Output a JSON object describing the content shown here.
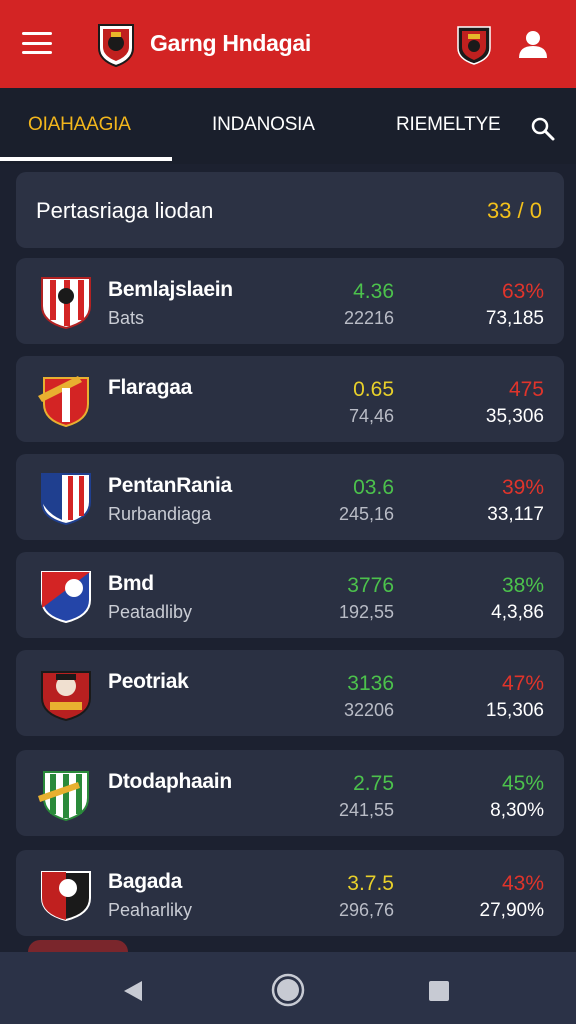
{
  "header": {
    "title": "Garng Hndagai",
    "menu_icon": "hamburger-menu-icon",
    "user_icon": "user-icon",
    "color": "#d32424"
  },
  "tabs": [
    {
      "label": "OIAHAAGIA",
      "active": true
    },
    {
      "label": "INDANOSIA",
      "active": false
    },
    {
      "label": "RIEMELTYE",
      "active": false
    }
  ],
  "summary": {
    "title": "Pertasriaga liodan",
    "score": "33 / 0"
  },
  "rows": [
    {
      "name": "Bemlajslaein",
      "sub": "Bats",
      "v1": "4.36",
      "v1_color": "#4cc24c",
      "v2": "22216",
      "p1": "63%",
      "p1_color": "#e0342b",
      "p2": "73,185"
    },
    {
      "name": "Flaragaa",
      "sub": "",
      "v1": "0.65",
      "v1_color": "#e8d02a",
      "v2": "74,46",
      "p1": "475",
      "p1_color": "#e0342b",
      "p2": "35,306"
    },
    {
      "name": "PentanRania",
      "sub": "Rurbandiaga",
      "v1": "03.6",
      "v1_color": "#4cc24c",
      "v2": "245,16",
      "p1": "39%",
      "p1_color": "#e0342b",
      "p2": "33,117"
    },
    {
      "name": "Bmd",
      "sub": "Peatadliby",
      "v1": "3776",
      "v1_color": "#4cc24c",
      "v2": "192,55",
      "p1": "38%",
      "p1_color": "#4cc24c",
      "p2": "4,3,86"
    },
    {
      "name": "Peotriak",
      "sub": "",
      "v1": "3136",
      "v1_color": "#4cc24c",
      "v2": "32206",
      "p1": "47%",
      "p1_color": "#e0342b",
      "p2": "15,306"
    },
    {
      "name": "Dtodaphaain",
      "sub": "",
      "v1": "2.75",
      "v1_color": "#4cc24c",
      "v2": "241,55",
      "p1": "45%",
      "p1_color": "#4cc24c",
      "p2": "8,30%"
    },
    {
      "name": "Bagada",
      "sub": "Peaharliky",
      "v1": "3.7.5",
      "v1_color": "#e8d02a",
      "v2": "296,76",
      "p1": "43%",
      "p1_color": "#e0342b",
      "p2": "27,90%"
    }
  ],
  "navbar": {
    "back_icon": "back-triangle-icon",
    "home_icon": "home-circle-icon",
    "recent_icon": "recent-square-icon"
  }
}
